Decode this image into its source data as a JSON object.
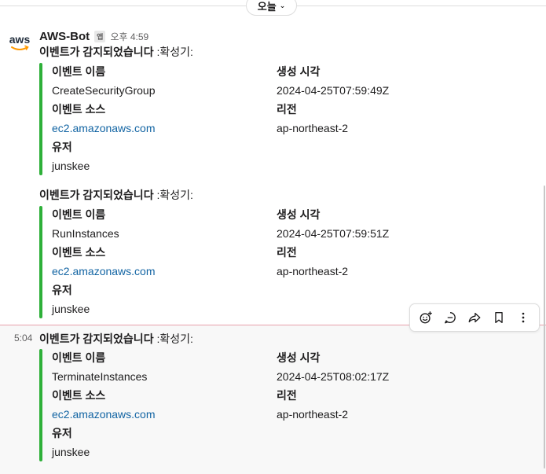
{
  "date_divider": {
    "label": "오늘"
  },
  "sender": {
    "name": "AWS-Bot",
    "badge": "앱",
    "timestamp": "오후 4:59",
    "avatar_text": "aws"
  },
  "labels": {
    "event_name": "이벤트 이름",
    "created_at": "생성 시각",
    "event_source": "이벤트 소스",
    "region": "리전",
    "user": "유저"
  },
  "messages": [
    {
      "hover_time": "",
      "intro_bold": "이벤트가 감지되었습니다",
      "intro_rest": " :확성기:",
      "event_name": "CreateSecurityGroup",
      "created_at": "2024-04-25T07:59:49Z",
      "event_source": "ec2.amazonaws.com",
      "region": "ap-northeast-2",
      "user": "junskee"
    },
    {
      "hover_time": "",
      "intro_bold": "이벤트가 감지되었습니다",
      "intro_rest": " :확성기:",
      "event_name": "RunInstances",
      "created_at": "2024-04-25T07:59:51Z",
      "event_source": "ec2.amazonaws.com",
      "region": "ap-northeast-2",
      "user": "junskee"
    },
    {
      "hover_time": "5:04",
      "intro_bold": "이벤트가 감지되었습니다",
      "intro_rest": " :확성기:",
      "event_name": "TerminateInstances",
      "created_at": "2024-04-25T08:02:17Z",
      "event_source": "ec2.amazonaws.com",
      "region": "ap-northeast-2",
      "user": "junskee"
    }
  ],
  "colors": {
    "attachment_bar": "#2eb039",
    "link": "#1264a3",
    "new_divider": "#e8a0ac"
  },
  "toolbar_icons": [
    "add-reaction-icon",
    "reply-in-thread-icon",
    "forward-icon",
    "bookmark-icon",
    "more-actions-icon"
  ]
}
